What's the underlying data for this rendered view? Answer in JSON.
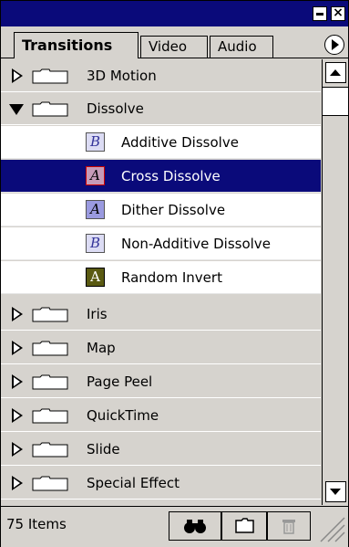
{
  "tabs": [
    "Transitions",
    "Video",
    "Audio"
  ],
  "active_tab": "Transitions",
  "folders_before": [
    {
      "label": "3D Motion",
      "expanded": false
    },
    {
      "label": "Dissolve",
      "expanded": true
    }
  ],
  "items": [
    {
      "label": "Additive Dissolve",
      "icon": "additive-dissolve-icon",
      "glyph": "B",
      "selected": false
    },
    {
      "label": "Cross Dissolve",
      "icon": "cross-dissolve-icon",
      "glyph": "A",
      "selected": true
    },
    {
      "label": "Dither Dissolve",
      "icon": "dither-dissolve-icon",
      "glyph": "A",
      "selected": false
    },
    {
      "label": "Non-Additive Dissolve",
      "icon": "non-additive-dissolve-icon",
      "glyph": "B",
      "selected": false
    },
    {
      "label": "Random Invert",
      "icon": "random-invert-icon",
      "glyph": "A",
      "selected": false
    }
  ],
  "folders_after": [
    {
      "label": "Iris"
    },
    {
      "label": "Map"
    },
    {
      "label": "Page Peel"
    },
    {
      "label": "QuickTime"
    },
    {
      "label": "Slide"
    },
    {
      "label": "Special Effect"
    }
  ],
  "status": {
    "count": "75 Items"
  },
  "colors": {
    "selection": "#0a0a7a",
    "titlebar": "#0a0a7a",
    "panel": "#d6d3ce"
  }
}
